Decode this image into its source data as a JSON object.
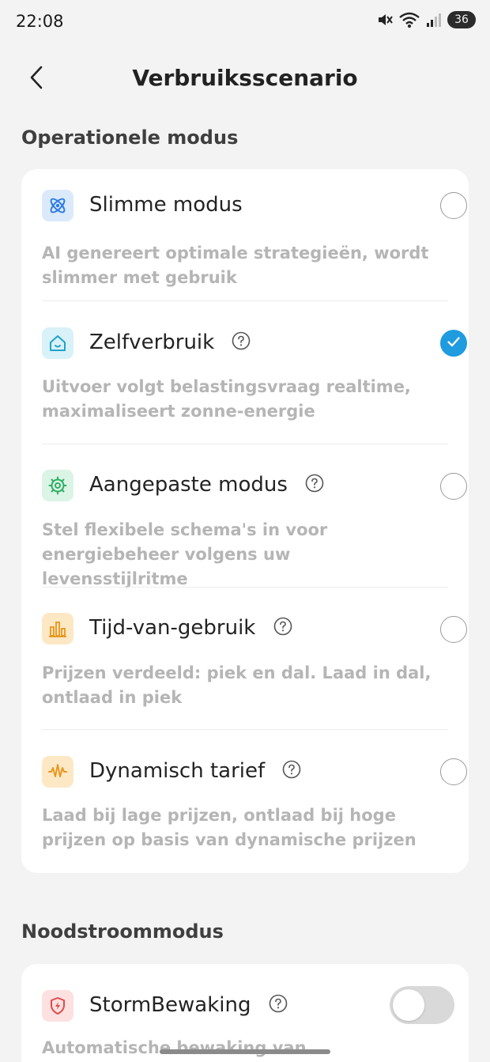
{
  "status_bar": {
    "time": "22:08",
    "icons": [
      "mute-icon",
      "wifi-icon",
      "signal-icon"
    ],
    "battery": "36"
  },
  "header": {
    "title": "Verbruiksscenario",
    "back_icon": "chevron-left-icon"
  },
  "operational": {
    "section_title": "Operationele modus",
    "options": [
      {
        "title": "Slimme modus",
        "description": "AI genereert optimale strategieën, wordt slimmer met gebruik",
        "icon": "atom-icon",
        "has_help": false,
        "selected": false
      },
      {
        "title": "Zelfverbruik",
        "description": "Uitvoer volgt belastingsvraag realtime, maximaliseert zonne-energie",
        "icon": "house-icon",
        "has_help": true,
        "selected": true
      },
      {
        "title": "Aangepaste modus",
        "description": "Stel flexibele schema's in voor energiebeheer volgens uw levensstijlritme",
        "icon": "gear-icon",
        "has_help": true,
        "selected": false
      },
      {
        "title": "Tijd-van-gebruik",
        "description": "Prijzen verdeeld: piek en dal. Laad in dal, ontlaad in piek",
        "icon": "bar-chart-icon",
        "has_help": true,
        "selected": false
      },
      {
        "title": "Dynamisch tarief",
        "description": "Laad bij lage prijzen, ontlaad bij hoge prijzen op basis van dynamische prijzen",
        "icon": "waveform-icon",
        "has_help": true,
        "selected": false
      }
    ]
  },
  "backup": {
    "section_title": "Noodstroommodus",
    "storm": {
      "title": "StormBewaking",
      "description": "Automatische bewaking van",
      "icon": "shield-bolt-icon",
      "enabled": false
    }
  },
  "colors": {
    "accent": "#1f9be0",
    "smart_icon_bg": "#dbeafb",
    "self_icon_bg": "#d9f1f8",
    "custom_icon_bg": "#dcf4e6",
    "tou_icon_bg": "#fde8c6",
    "dynamic_icon_bg": "#fde8c6",
    "storm_icon_bg": "#fde0e0"
  }
}
